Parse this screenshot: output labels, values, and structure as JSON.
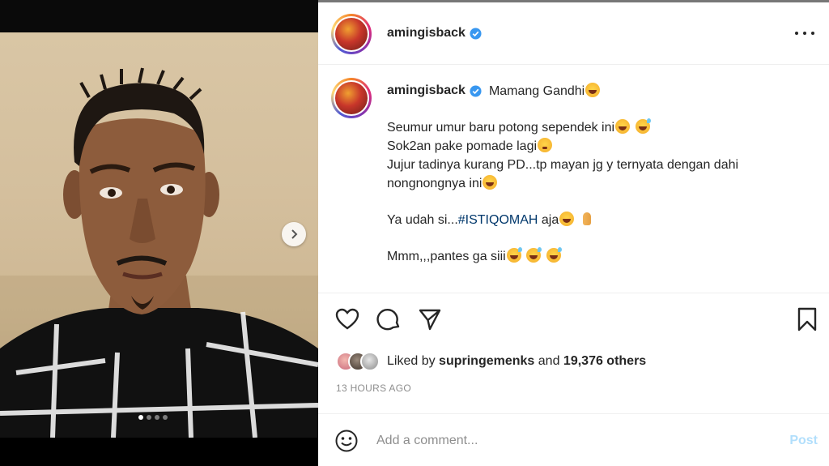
{
  "post": {
    "username": "amingisback",
    "caption_title": "Mamang Gandhi",
    "caption_lines": [
      "Seumur umur baru potong sependek ini",
      "Sok2an pake pomade lagi",
      "Jujur tadinya kurang PD...tp mayan jg y ternyata dengan dahi",
      "nongnongnya ini"
    ],
    "line_ya_prefix": "Ya udah si...",
    "hashtag": "#ISTIQOMAH",
    "line_ya_suffix": "aja",
    "line_last": "Mmm,,,pantes ga siii",
    "likes": {
      "prefix": "Liked by",
      "user": "supringemenks",
      "joiner": "and",
      "others": "19,376 others"
    },
    "timestamp": "13 HOURS AGO"
  },
  "comment": {
    "placeholder": "Add a comment...",
    "post_label": "Post"
  },
  "carousel": {
    "slides": 4,
    "active": 1
  },
  "colors": {
    "verified": "#3897f0",
    "hashtag": "#00376b",
    "post_disabled": "#b2dffc",
    "timestamp": "#8e8e8e"
  }
}
